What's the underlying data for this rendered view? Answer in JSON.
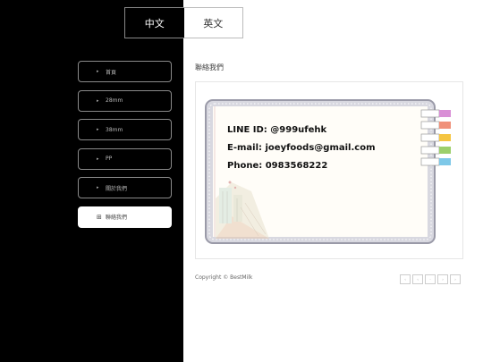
{
  "top_tabs": [
    {
      "label": "中文",
      "theme": "dark"
    },
    {
      "label": "英文",
      "theme": "light"
    }
  ],
  "menu": [
    {
      "label": "首頁",
      "icon": "home-icon",
      "glyph": "▸",
      "active": false
    },
    {
      "label": "28mm",
      "icon": "item-icon",
      "glyph": "▸",
      "active": false
    },
    {
      "label": "38mm",
      "icon": "item-icon",
      "glyph": "▸",
      "active": false
    },
    {
      "label": "PP",
      "icon": "item-icon",
      "glyph": "▸",
      "active": false
    },
    {
      "label": "關於我們",
      "icon": "info-icon",
      "glyph": "▸",
      "active": false
    },
    {
      "label": "聯絡我們",
      "icon": "grid-icon",
      "glyph": "⊞",
      "active": true
    }
  ],
  "main": {
    "section_title": "聯絡我們",
    "card": {
      "line_id": "LINE ID: @999ufehk",
      "email": "E-mail: joeyfoods@gmail.com",
      "phone": "Phone: 0983568222"
    }
  },
  "footer": {
    "copyright": "Copyright © BestMilk",
    "pager": [
      "‹",
      "‹",
      "·",
      "›",
      "›"
    ]
  },
  "colors": {
    "sidebar_bg": "#000000",
    "tab_colors": [
      "#d98fd6",
      "#f0917a",
      "#f5c542",
      "#9ccf6a",
      "#7ec8e8"
    ]
  }
}
